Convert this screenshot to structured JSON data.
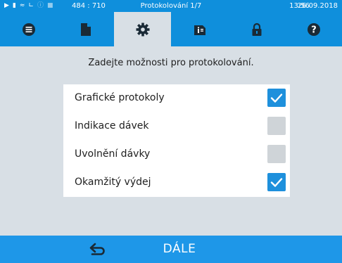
{
  "status_bar": {
    "coords": "484 : 710",
    "title": "Protokolování 1/7",
    "time": "13:56",
    "date": "26.09.2018",
    "icons": [
      "play-icon",
      "battery-icon",
      "steam-icon",
      "graph-icon",
      "info-icon",
      "lock-icon"
    ]
  },
  "tabs": [
    {
      "name": "menu",
      "icon": "list-icon"
    },
    {
      "name": "document",
      "icon": "document-icon"
    },
    {
      "name": "settings",
      "icon": "gear-icon",
      "active": true
    },
    {
      "name": "info",
      "icon": "info-card-icon"
    },
    {
      "name": "lock",
      "icon": "lock-icon"
    },
    {
      "name": "help",
      "icon": "question-icon"
    }
  ],
  "prompt": "Zadejte možnosti pro protokolování.",
  "options": [
    {
      "label": "Grafické protokoly",
      "checked": true
    },
    {
      "label": "Indikace dávek",
      "checked": false
    },
    {
      "label": "Uvolnění dávky",
      "checked": false
    },
    {
      "label": "Okamžitý výdej",
      "checked": true
    }
  ],
  "footer": {
    "back_icon": "back-arrow-icon",
    "next_label": "DÁLE"
  },
  "colors": {
    "accent": "#0f8fdc",
    "footer": "#1e97e8",
    "background": "#d8dfe5",
    "checked": "#1e90dc",
    "unchecked": "#cfd4d8"
  }
}
